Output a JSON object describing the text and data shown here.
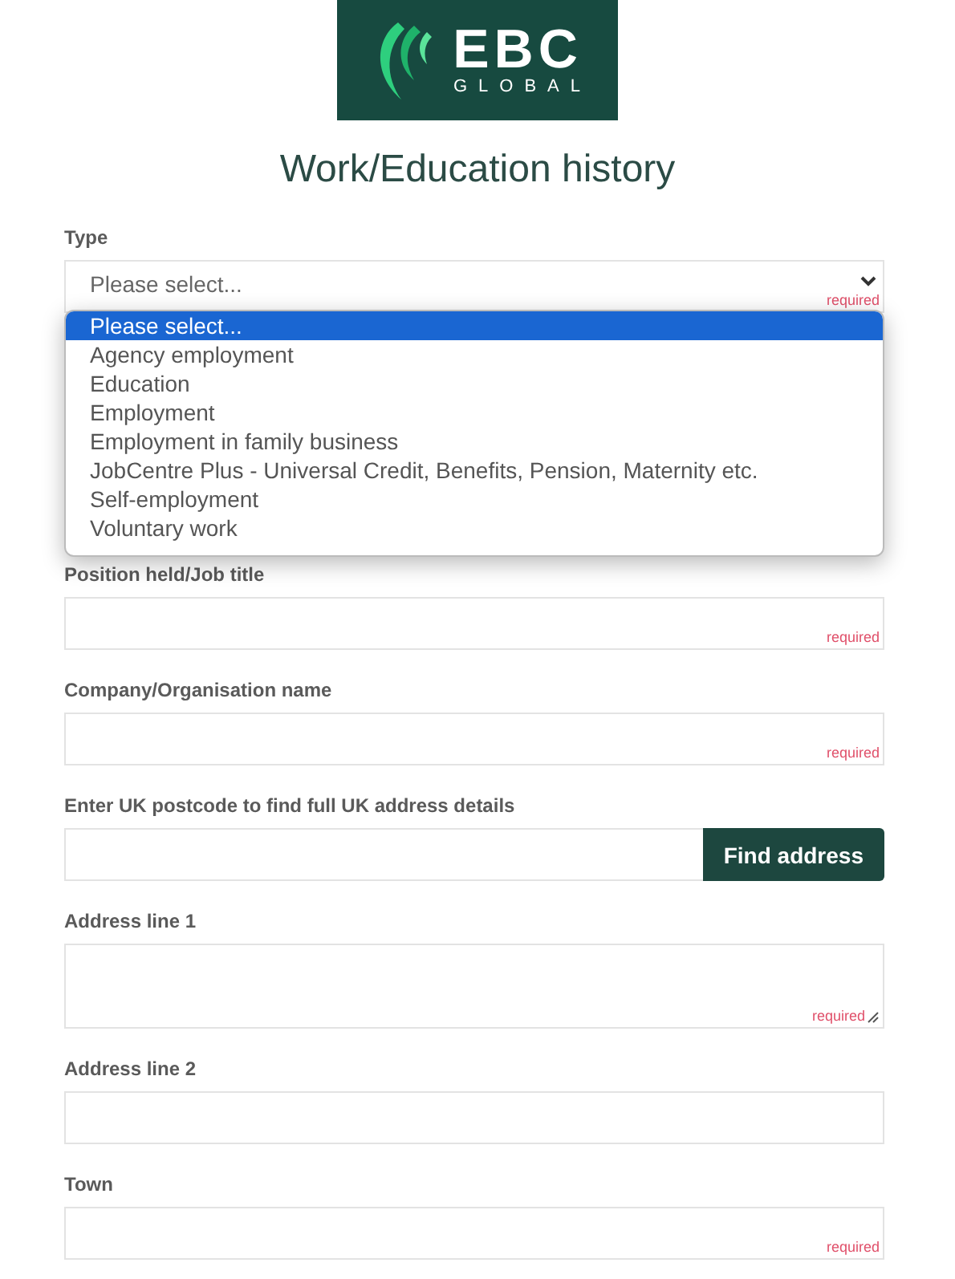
{
  "logo": {
    "wordmark": "EBC",
    "tagline": "GLOBAL"
  },
  "title": "Work/Education history",
  "fields": [
    {
      "kind": "select",
      "label": "Type",
      "value": "Please select...",
      "required": "required",
      "open": true,
      "options": [
        {
          "label": "Please select...",
          "selected": true
        },
        {
          "label": "Agency employment",
          "selected": false
        },
        {
          "label": "Education",
          "selected": false
        },
        {
          "label": "Employment",
          "selected": false
        },
        {
          "label": "Employment in family business",
          "selected": false
        },
        {
          "label": "JobCentre Plus - Universal Credit, Benefits, Pension, Maternity etc.",
          "selected": false
        },
        {
          "label": "Self-employment",
          "selected": false
        },
        {
          "label": "Voluntary work",
          "selected": false
        }
      ]
    },
    {
      "kind": "text",
      "label": "Position held/Job title",
      "required": "required"
    },
    {
      "kind": "text",
      "label": "Company/Organisation name",
      "required": "required"
    },
    {
      "kind": "postcode",
      "label": "Enter UK postcode to find full UK address details",
      "button": "Find address"
    },
    {
      "kind": "textarea",
      "label": "Address line 1",
      "required": "required"
    },
    {
      "kind": "text",
      "label": "Address line 2"
    },
    {
      "kind": "text",
      "label": "Town",
      "required": "required"
    }
  ]
}
